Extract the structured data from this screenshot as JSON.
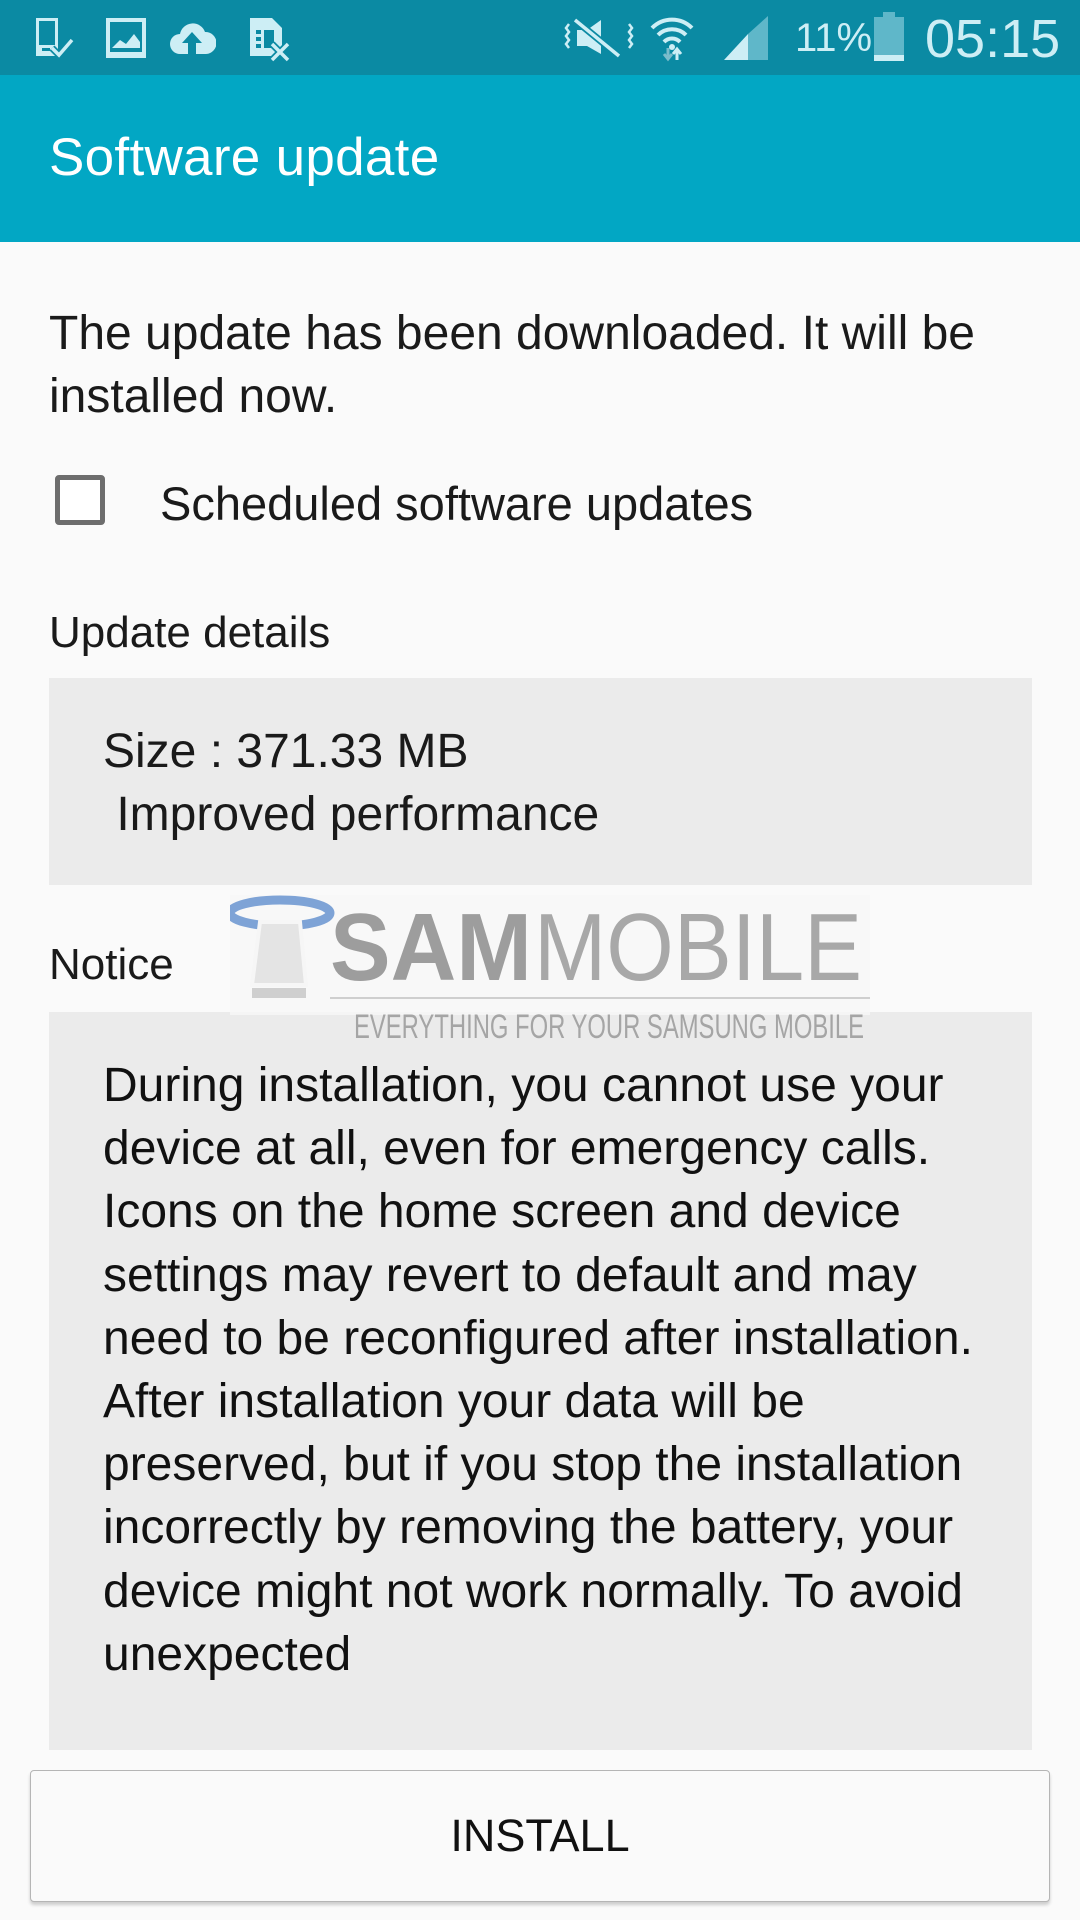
{
  "status_bar": {
    "left_icons": [
      "device-check-icon",
      "image-icon",
      "cloud-upload-icon",
      "sim-card-error-icon"
    ],
    "right_icons": [
      "vibrate-mute-icon",
      "wifi-icon",
      "signal-icon",
      "battery-icon"
    ],
    "battery_percent": "11%",
    "time": "05:15",
    "colors": {
      "bar": "#0b8aa3",
      "icon": "#cdeef5"
    }
  },
  "header": {
    "title": "Software update",
    "color": "#02a7c4"
  },
  "intro_text": "The update has been downloaded. It will be installed now.",
  "scheduled_updates": {
    "label": "Scheduled software updates",
    "checked": false
  },
  "update_details": {
    "heading": "Update details",
    "size_line": "Size : 371.33 MB",
    "description_line": " Improved performance"
  },
  "notice": {
    "heading": "Notice",
    "text": "During installation, you cannot use your device at all, even for emergency calls. Icons on the home screen and device settings may revert to default and may need to be reconfigured after installation. After installation your data will be preserved, but if you stop the installation incorrectly by removing the battery, your device might not work normally. To avoid unexpected"
  },
  "watermark": {
    "brand_bold": "SAM",
    "brand_light": "MOBILE",
    "tagline": "EVERYTHING FOR YOUR SAMSUNG MOBILE"
  },
  "install_button": {
    "label": "INSTALL"
  }
}
